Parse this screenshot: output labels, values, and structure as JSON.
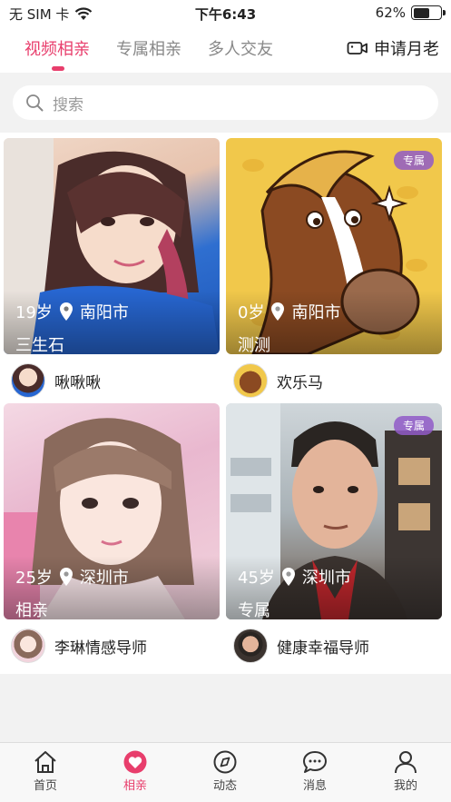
{
  "status": {
    "carrier": "无 SIM 卡",
    "time": "下午6:43",
    "battery": "62%",
    "battery_level": 0.62
  },
  "tabs": [
    {
      "label": "视频相亲"
    },
    {
      "label": "专属相亲"
    },
    {
      "label": "多人交友"
    }
  ],
  "apply_label": "申请月老",
  "search": {
    "placeholder": "搜索"
  },
  "cards": [
    {
      "age": "19岁",
      "city": "南阳市",
      "tag": "三生石",
      "name": "啾啾啾",
      "badge": ""
    },
    {
      "age": "0岁",
      "city": "南阳市",
      "tag": "测测",
      "name": "欢乐马",
      "badge": "专属"
    },
    {
      "age": "25岁",
      "city": "深圳市",
      "tag": "相亲",
      "name": "李琳情感导师",
      "badge": ""
    },
    {
      "age": "45岁",
      "city": "深圳市",
      "tag": "专属",
      "name": "健康幸福导师",
      "badge": "专属"
    }
  ],
  "tabbar": [
    {
      "label": "首页",
      "icon": "home-icon"
    },
    {
      "label": "相亲",
      "icon": "heart-icon"
    },
    {
      "label": "动态",
      "icon": "compass-icon"
    },
    {
      "label": "消息",
      "icon": "chat-icon"
    },
    {
      "label": "我的",
      "icon": "person-icon"
    }
  ],
  "colors": {
    "accent": "#e83e6c",
    "badge": "#915ac8"
  }
}
